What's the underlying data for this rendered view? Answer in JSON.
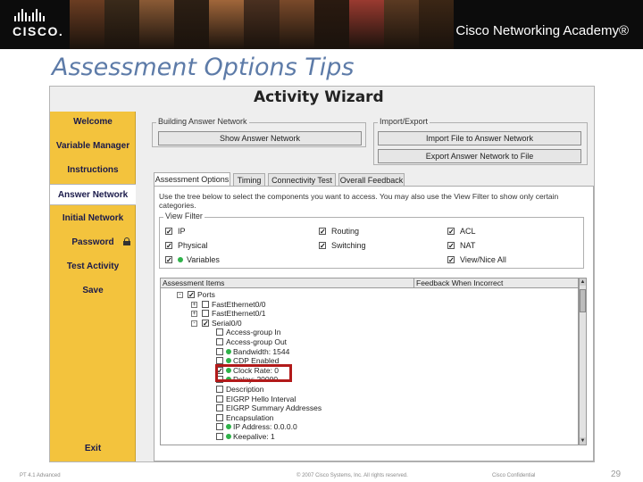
{
  "header": {
    "brand": "CISCO.",
    "academy": "Cisco Networking Academy®",
    "photo_colors": [
      "#6b3d22",
      "#3a2a1a",
      "#8a5a35",
      "#2c1f14",
      "#a0663a",
      "#4a3020",
      "#7a4a2a",
      "#2a1a10",
      "#9a3a30",
      "#5b3a22",
      "#3b2615"
    ]
  },
  "slide": {
    "title": "Assessment Options Tips"
  },
  "wizard": {
    "title": "Activity Wizard",
    "sidebar": [
      {
        "label": "Welcome"
      },
      {
        "label": "Variable Manager"
      },
      {
        "label": "Instructions"
      },
      {
        "label": "Answer Network"
      },
      {
        "label": "Initial Network"
      },
      {
        "label": "Password"
      },
      {
        "label": "Test Activity"
      },
      {
        "label": "Save"
      },
      {
        "label": "Exit"
      }
    ],
    "building": {
      "legend": "Building Answer Network",
      "show_button": "Show Answer Network"
    },
    "import_export": {
      "legend": "Import/Export",
      "import_button": "Import File to Answer Network",
      "export_button": "Export Answer Network to File"
    },
    "tabs": [
      {
        "label": "Assessment Options"
      },
      {
        "label": "Timing"
      },
      {
        "label": "Connectivity Test"
      },
      {
        "label": "Overall Feedback"
      }
    ],
    "description": "Use the tree below to select the components you want to access. You may also use the View Filter to show only certain categories.",
    "view_filter": {
      "legend": "View Filter",
      "items": [
        {
          "label": "IP",
          "checked": true
        },
        {
          "label": "Routing",
          "checked": true
        },
        {
          "label": "ACL",
          "checked": true
        },
        {
          "label": "Physical",
          "checked": true
        },
        {
          "label": "Switching",
          "checked": true
        },
        {
          "label": "NAT",
          "checked": true
        },
        {
          "label": "Variables",
          "checked": true
        },
        {
          "label": "View/Nice All",
          "checked": true
        }
      ]
    },
    "table": {
      "col_items": "Assessment Items",
      "col_feedback": "Feedback When Incorrect",
      "rows": [
        {
          "label": "Ports",
          "checked": true,
          "dot": false
        },
        {
          "label": "FastEthernet0/0",
          "checked": false,
          "dot": false
        },
        {
          "label": "FastEthernet0/1",
          "checked": false,
          "dot": false
        },
        {
          "label": "Serial0/0",
          "checked": true,
          "dot": false
        },
        {
          "label": "Access-group In",
          "checked": false,
          "dot": false
        },
        {
          "label": "Access-group Out",
          "checked": false,
          "dot": false
        },
        {
          "label": "Bandwidth: 1544",
          "checked": false,
          "dot": true
        },
        {
          "label": "CDP Enabled",
          "checked": false,
          "dot": true
        },
        {
          "label": "Clock Rate: 0",
          "checked": true,
          "dot": true
        },
        {
          "label": "Delay: 20000",
          "checked": false,
          "dot": true
        },
        {
          "label": "Description",
          "checked": false,
          "dot": false
        },
        {
          "label": "EIGRP Hello Interval",
          "checked": false,
          "dot": false
        },
        {
          "label": "EIGRP Summary Addresses",
          "checked": false,
          "dot": false
        },
        {
          "label": "Encapsulation",
          "checked": false,
          "dot": false
        },
        {
          "label": "IP Address: 0.0.0.0",
          "checked": false,
          "dot": true
        },
        {
          "label": "Keepalive: 1",
          "checked": false,
          "dot": true
        }
      ]
    }
  },
  "footer": {
    "left": "PT 4.1 Advanced",
    "center": "© 2007 Cisco Systems, Inc. All rights reserved.",
    "right": "Cisco Confidential",
    "page": "29"
  }
}
